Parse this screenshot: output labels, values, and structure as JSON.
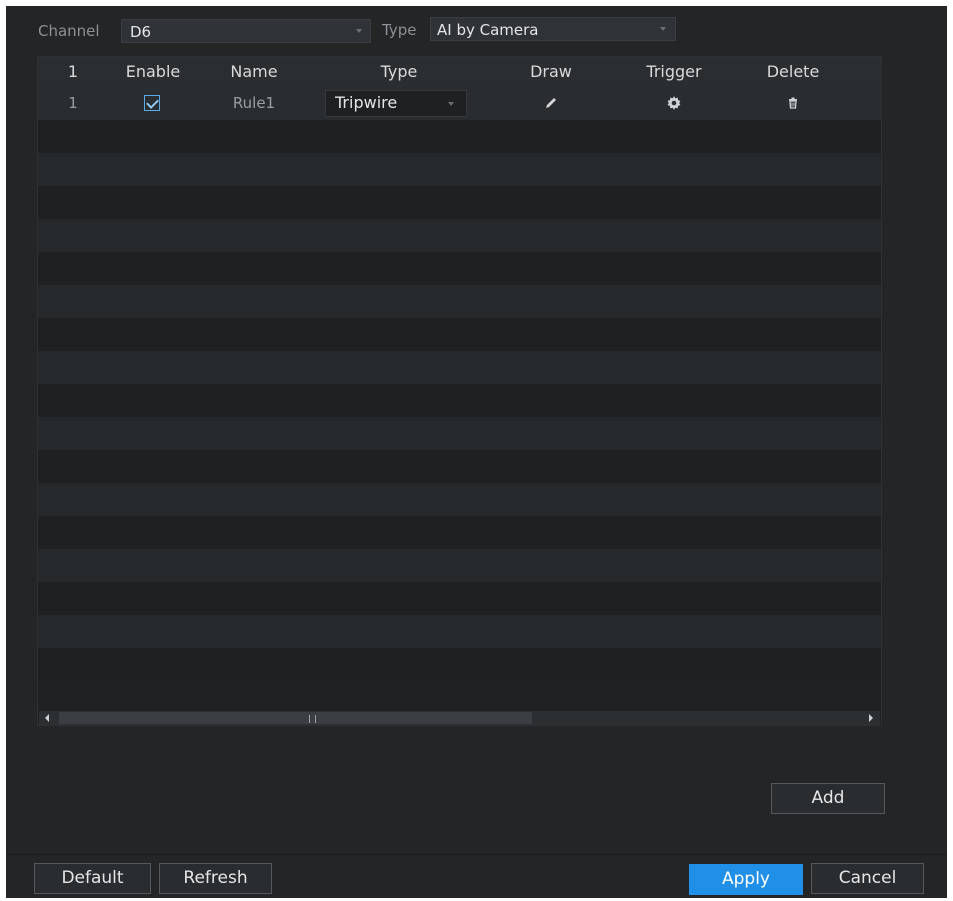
{
  "filters": {
    "channel_label": "Channel",
    "channel_value": "D6",
    "type_label": "Type",
    "type_value": "AI by Camera"
  },
  "table": {
    "columns": [
      "1",
      "Enable",
      "Name",
      "Type",
      "Draw",
      "Trigger",
      "Delete"
    ],
    "rows": [
      {
        "index": "1",
        "enabled": true,
        "name": "Rule1",
        "type": "Tripwire",
        "draw_icon": "pencil-icon",
        "trigger_icon": "gear-icon",
        "delete_icon": "trash-icon"
      }
    ]
  },
  "buttons": {
    "add": "Add",
    "default": "Default",
    "refresh": "Refresh",
    "apply": "Apply",
    "cancel": "Cancel"
  },
  "colors": {
    "panel_bg": "#232527",
    "accent": "#1f8fe8"
  }
}
